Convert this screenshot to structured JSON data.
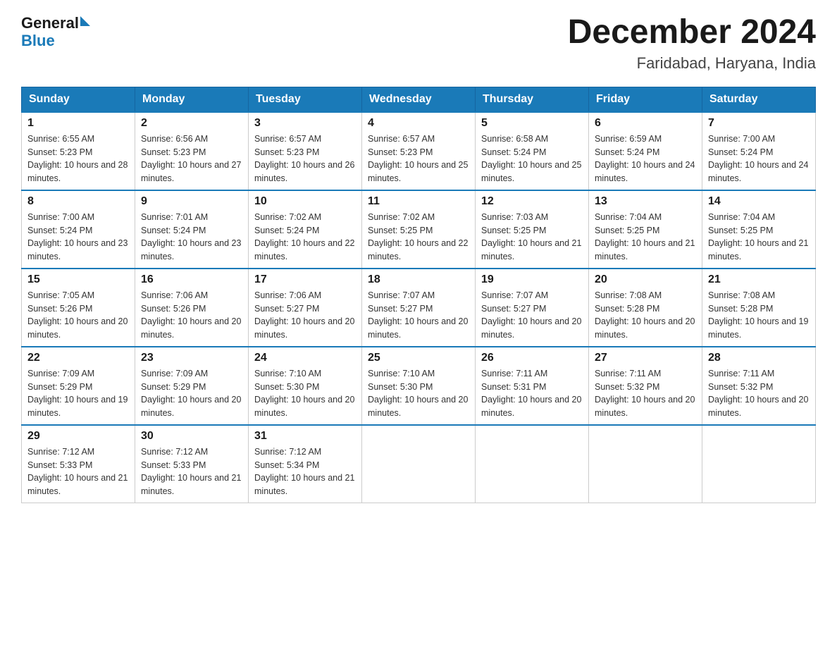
{
  "header": {
    "logo_text_general": "General",
    "logo_text_blue": "Blue",
    "month_title": "December 2024",
    "location": "Faridabad, Haryana, India"
  },
  "days_of_week": [
    "Sunday",
    "Monday",
    "Tuesday",
    "Wednesday",
    "Thursday",
    "Friday",
    "Saturday"
  ],
  "weeks": [
    [
      {
        "day": "1",
        "sunrise": "6:55 AM",
        "sunset": "5:23 PM",
        "daylight": "10 hours and 28 minutes."
      },
      {
        "day": "2",
        "sunrise": "6:56 AM",
        "sunset": "5:23 PM",
        "daylight": "10 hours and 27 minutes."
      },
      {
        "day": "3",
        "sunrise": "6:57 AM",
        "sunset": "5:23 PM",
        "daylight": "10 hours and 26 minutes."
      },
      {
        "day": "4",
        "sunrise": "6:57 AM",
        "sunset": "5:23 PM",
        "daylight": "10 hours and 25 minutes."
      },
      {
        "day": "5",
        "sunrise": "6:58 AM",
        "sunset": "5:24 PM",
        "daylight": "10 hours and 25 minutes."
      },
      {
        "day": "6",
        "sunrise": "6:59 AM",
        "sunset": "5:24 PM",
        "daylight": "10 hours and 24 minutes."
      },
      {
        "day": "7",
        "sunrise": "7:00 AM",
        "sunset": "5:24 PM",
        "daylight": "10 hours and 24 minutes."
      }
    ],
    [
      {
        "day": "8",
        "sunrise": "7:00 AM",
        "sunset": "5:24 PM",
        "daylight": "10 hours and 23 minutes."
      },
      {
        "day": "9",
        "sunrise": "7:01 AM",
        "sunset": "5:24 PM",
        "daylight": "10 hours and 23 minutes."
      },
      {
        "day": "10",
        "sunrise": "7:02 AM",
        "sunset": "5:24 PM",
        "daylight": "10 hours and 22 minutes."
      },
      {
        "day": "11",
        "sunrise": "7:02 AM",
        "sunset": "5:25 PM",
        "daylight": "10 hours and 22 minutes."
      },
      {
        "day": "12",
        "sunrise": "7:03 AM",
        "sunset": "5:25 PM",
        "daylight": "10 hours and 21 minutes."
      },
      {
        "day": "13",
        "sunrise": "7:04 AM",
        "sunset": "5:25 PM",
        "daylight": "10 hours and 21 minutes."
      },
      {
        "day": "14",
        "sunrise": "7:04 AM",
        "sunset": "5:25 PM",
        "daylight": "10 hours and 21 minutes."
      }
    ],
    [
      {
        "day": "15",
        "sunrise": "7:05 AM",
        "sunset": "5:26 PM",
        "daylight": "10 hours and 20 minutes."
      },
      {
        "day": "16",
        "sunrise": "7:06 AM",
        "sunset": "5:26 PM",
        "daylight": "10 hours and 20 minutes."
      },
      {
        "day": "17",
        "sunrise": "7:06 AM",
        "sunset": "5:27 PM",
        "daylight": "10 hours and 20 minutes."
      },
      {
        "day": "18",
        "sunrise": "7:07 AM",
        "sunset": "5:27 PM",
        "daylight": "10 hours and 20 minutes."
      },
      {
        "day": "19",
        "sunrise": "7:07 AM",
        "sunset": "5:27 PM",
        "daylight": "10 hours and 20 minutes."
      },
      {
        "day": "20",
        "sunrise": "7:08 AM",
        "sunset": "5:28 PM",
        "daylight": "10 hours and 20 minutes."
      },
      {
        "day": "21",
        "sunrise": "7:08 AM",
        "sunset": "5:28 PM",
        "daylight": "10 hours and 19 minutes."
      }
    ],
    [
      {
        "day": "22",
        "sunrise": "7:09 AM",
        "sunset": "5:29 PM",
        "daylight": "10 hours and 19 minutes."
      },
      {
        "day": "23",
        "sunrise": "7:09 AM",
        "sunset": "5:29 PM",
        "daylight": "10 hours and 20 minutes."
      },
      {
        "day": "24",
        "sunrise": "7:10 AM",
        "sunset": "5:30 PM",
        "daylight": "10 hours and 20 minutes."
      },
      {
        "day": "25",
        "sunrise": "7:10 AM",
        "sunset": "5:30 PM",
        "daylight": "10 hours and 20 minutes."
      },
      {
        "day": "26",
        "sunrise": "7:11 AM",
        "sunset": "5:31 PM",
        "daylight": "10 hours and 20 minutes."
      },
      {
        "day": "27",
        "sunrise": "7:11 AM",
        "sunset": "5:32 PM",
        "daylight": "10 hours and 20 minutes."
      },
      {
        "day": "28",
        "sunrise": "7:11 AM",
        "sunset": "5:32 PM",
        "daylight": "10 hours and 20 minutes."
      }
    ],
    [
      {
        "day": "29",
        "sunrise": "7:12 AM",
        "sunset": "5:33 PM",
        "daylight": "10 hours and 21 minutes."
      },
      {
        "day": "30",
        "sunrise": "7:12 AM",
        "sunset": "5:33 PM",
        "daylight": "10 hours and 21 minutes."
      },
      {
        "day": "31",
        "sunrise": "7:12 AM",
        "sunset": "5:34 PM",
        "daylight": "10 hours and 21 minutes."
      },
      null,
      null,
      null,
      null
    ]
  ]
}
